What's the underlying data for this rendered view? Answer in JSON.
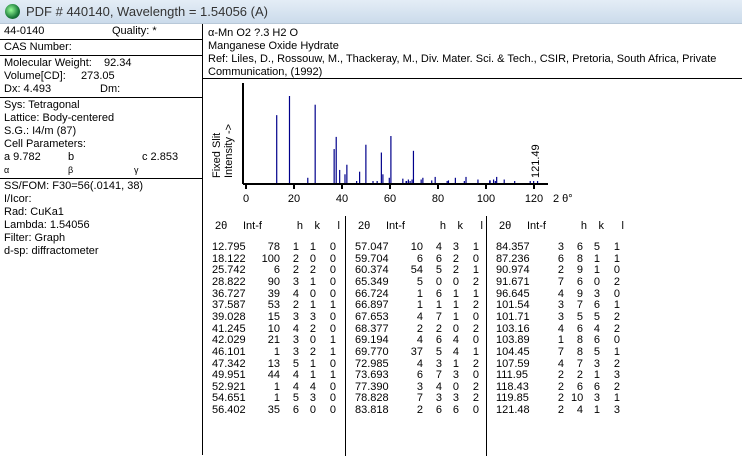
{
  "window": {
    "title": "PDF # 440140,  Wavelength = 1.54056   (A)"
  },
  "left": {
    "pdf_number": "44-0140",
    "quality": "Quality: *",
    "cas": "CAS Number:",
    "mol_weight_label": "Molecular Weight:",
    "mol_weight": "92.34",
    "volume_label": "Volume[CD]:",
    "volume": "273.05",
    "dx": "Dx:  4.493",
    "dm": "Dm:",
    "sys": "Sys: Tetragonal",
    "lattice": "Lattice: Body-centered",
    "sg": "S.G.: I4/m (87)",
    "cell": "Cell Parameters:",
    "a": "a  9.782",
    "b": "b",
    "c": "c  2.853",
    "alpha": "α",
    "beta": "β",
    "gamma": "γ",
    "ssfom": "SS/FOM: F30=56(.0141, 38)",
    "icor": "I/Icor:",
    "rad": "Rad: CuKa1",
    "lambda": "Lambda: 1.54056",
    "filter": "Filter: Graph",
    "dsp": "d-sp: diffractometer"
  },
  "header": {
    "formula": "α-Mn O2 ?.3 H2 O",
    "name": "Manganese Oxide Hydrate",
    "ref1": "Ref: Liles, D., Rossouw, M., Thackeray, M., Div. Mater. Sci. & Tech., CSIR, Pretoria, South Africa, Private",
    "ref2": "Communication, (1992)"
  },
  "chart_data": {
    "type": "bar",
    "ylabel1": "Fixed   Slit",
    "ylabel2": "Intensity  ->",
    "xlabel": "2 θ°",
    "xticks": [
      "0",
      "20",
      "40",
      "60",
      "80",
      "100",
      "120"
    ],
    "xlim": [
      0,
      125
    ],
    "ylim": [
      0,
      100
    ],
    "max_label": "121.49"
  },
  "table": {
    "headers": [
      "2θ",
      "Int-f",
      "h",
      "k",
      "l"
    ],
    "rows": [
      [
        "12.795",
        "78",
        "1",
        "1",
        "0"
      ],
      [
        "18.122",
        "100",
        "2",
        "0",
        "0"
      ],
      [
        "25.742",
        "6",
        "2",
        "2",
        "0"
      ],
      [
        "28.822",
        "90",
        "3",
        "1",
        "0"
      ],
      [
        "36.727",
        "39",
        "4",
        "0",
        "0"
      ],
      [
        "37.587",
        "53",
        "2",
        "1",
        "1"
      ],
      [
        "39.028",
        "15",
        "3",
        "3",
        "0"
      ],
      [
        "41.245",
        "10",
        "4",
        "2",
        "0"
      ],
      [
        "42.029",
        "21",
        "3",
        "0",
        "1"
      ],
      [
        "46.101",
        "1",
        "3",
        "2",
        "1"
      ],
      [
        "47.342",
        "13",
        "5",
        "1",
        "0"
      ],
      [
        "49.951",
        "44",
        "4",
        "1",
        "1"
      ],
      [
        "52.921",
        "1",
        "4",
        "4",
        "0"
      ],
      [
        "54.651",
        "1",
        "5",
        "3",
        "0"
      ],
      [
        "56.402",
        "35",
        "6",
        "0",
        "0"
      ],
      [
        "57.047",
        "10",
        "4",
        "3",
        "1"
      ],
      [
        "59.704",
        "6",
        "6",
        "2",
        "0"
      ],
      [
        "60.374",
        "54",
        "5",
        "2",
        "1"
      ],
      [
        "65.349",
        "5",
        "0",
        "0",
        "2"
      ],
      [
        "66.724",
        "1",
        "6",
        "1",
        "1"
      ],
      [
        "66.897",
        "1",
        "1",
        "1",
        "2"
      ],
      [
        "67.653",
        "4",
        "7",
        "1",
        "0"
      ],
      [
        "68.377",
        "2",
        "2",
        "0",
        "2"
      ],
      [
        "69.194",
        "4",
        "6",
        "4",
        "0"
      ],
      [
        "69.770",
        "37",
        "5",
        "4",
        "1"
      ],
      [
        "72.985",
        "4",
        "3",
        "1",
        "2"
      ],
      [
        "73.693",
        "6",
        "7",
        "3",
        "0"
      ],
      [
        "77.390",
        "3",
        "4",
        "0",
        "2"
      ],
      [
        "78.828",
        "7",
        "3",
        "3",
        "2"
      ],
      [
        "83.818",
        "2",
        "6",
        "6",
        "0"
      ],
      [
        "84.357",
        "3",
        "6",
        "5",
        "1"
      ],
      [
        "87.236",
        "6",
        "8",
        "1",
        "1"
      ],
      [
        "90.974",
        "2",
        "9",
        "1",
        "0"
      ],
      [
        "91.671",
        "7",
        "6",
        "0",
        "2"
      ],
      [
        "96.645",
        "4",
        "9",
        "3",
        "0"
      ],
      [
        "101.54",
        "3",
        "7",
        "6",
        "1"
      ],
      [
        "101.71",
        "3",
        "5",
        "5",
        "2"
      ],
      [
        "103.16",
        "4",
        "6",
        "4",
        "2"
      ],
      [
        "103.89",
        "1",
        "8",
        "6",
        "0"
      ],
      [
        "104.45",
        "7",
        "8",
        "5",
        "1"
      ],
      [
        "107.59",
        "4",
        "7",
        "3",
        "2"
      ],
      [
        "111.95",
        "2",
        "2",
        "1",
        "3"
      ],
      [
        "118.43",
        "2",
        "6",
        "6",
        "2"
      ],
      [
        "119.85",
        "2",
        "10",
        "3",
        "1"
      ],
      [
        "121.48",
        "2",
        "4",
        "1",
        "3"
      ]
    ]
  },
  "colors": {
    "peak": "#00008b",
    "titlebar": "#d6e3f0"
  }
}
